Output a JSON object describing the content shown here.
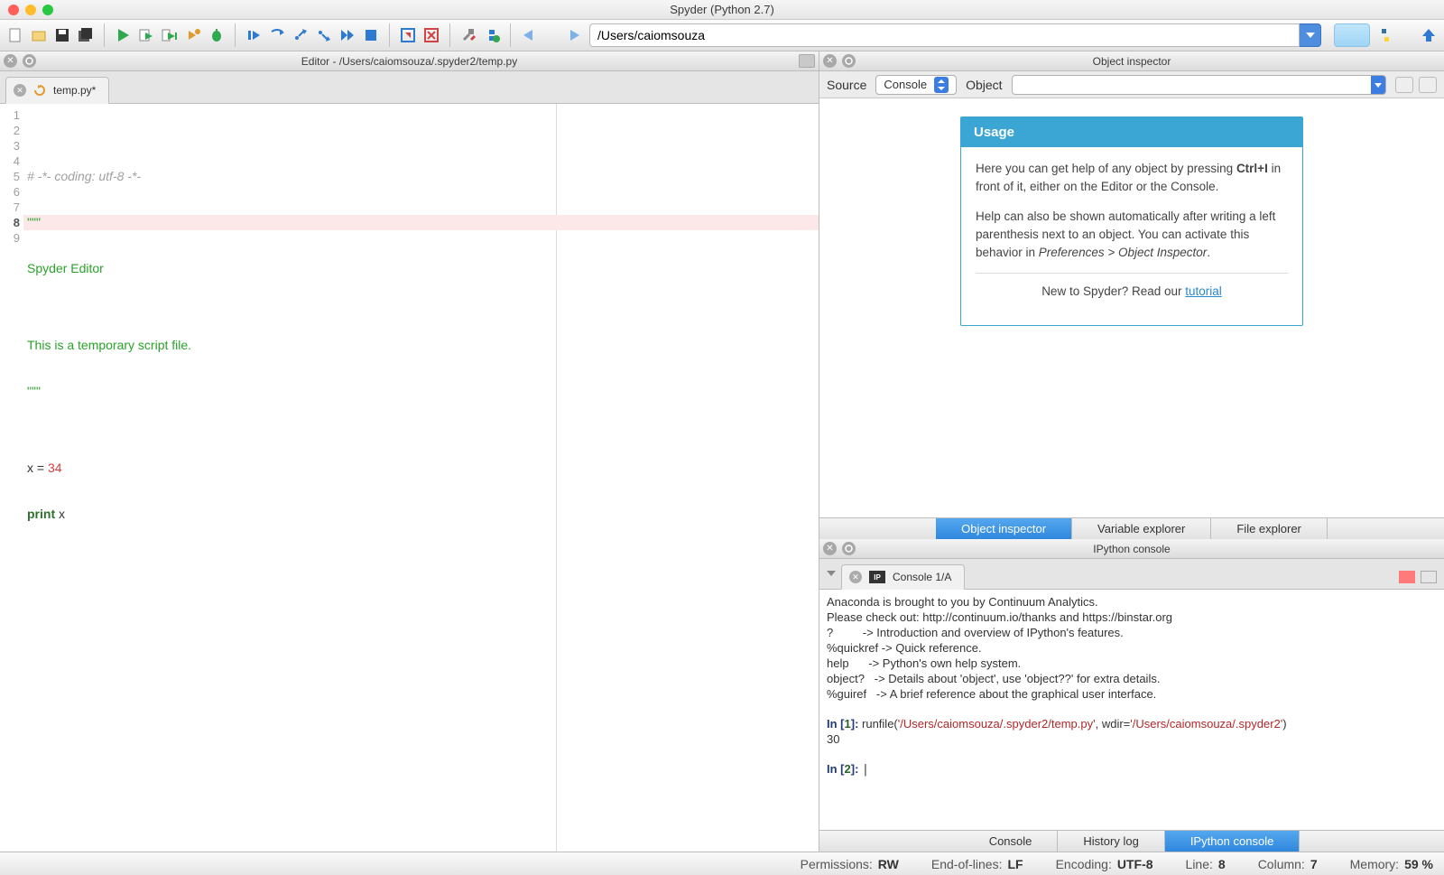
{
  "titlebar": {
    "title": "Spyder (Python 2.7)"
  },
  "toolbar": {
    "path_value": "/Users/caiomsouza"
  },
  "editor": {
    "pane_title": "Editor - /Users/caiomsouza/.spyder2/temp.py",
    "tab_label": "temp.py*",
    "lines": {
      "1": "# -*- coding: utf-8 -*-",
      "2": "\"\"\"",
      "3": "Spyder Editor",
      "4": "",
      "5": "This is a temporary script file.",
      "6": "\"\"\"",
      "7": "",
      "8a": "x ",
      "8b": "= ",
      "8c": "34",
      "9a": "print",
      "9b": " x"
    },
    "linenos": {
      "1": "1",
      "2": "2",
      "3": "3",
      "4": "4",
      "5": "5",
      "6": "6",
      "7": "7",
      "8": "8",
      "9": "9"
    }
  },
  "inspector": {
    "pane_title": "Object inspector",
    "source_label": "Source",
    "source_value": "Console",
    "object_label": "Object",
    "usage_header": "Usage",
    "usage_p1a": "Here you can get help of any object by pressing ",
    "usage_p1b": "Ctrl+I",
    "usage_p1c": " in front of it, either on the Editor or the Console.",
    "usage_p2a": "Help can also be shown automatically after writing a left parenthesis next to an object. You can activate this behavior in ",
    "usage_p2b": "Preferences > Object Inspector",
    "usage_p2c": ".",
    "tutorial_a": "New to Spyder? Read our ",
    "tutorial_link": "tutorial",
    "subtabs": {
      "obj": "Object inspector",
      "var": "Variable explorer",
      "file": "File explorer"
    }
  },
  "ipython": {
    "pane_title": "IPython console",
    "tab_label": "Console 1/A",
    "text_block": "Anaconda is brought to you by Continuum Analytics.\nPlease check out: http://continuum.io/thanks and https://binstar.org\n?         -> Introduction and overview of IPython's features.\n%quickref -> Quick reference.\nhelp      -> Python's own help system.\nobject?   -> Details about 'object', use 'object??' for extra details.\n%guiref   -> A brief reference about the graphical user interface.\n",
    "in1_pre": "In [",
    "in1_num": "1",
    "in1_post": "]: ",
    "in1_call": "runfile(",
    "in1_arg1": "'/Users/caiomsouza/.spyder2/temp.py'",
    "in1_mid": ", wdir=",
    "in1_arg2": "'/Users/caiomsouza/.spyder2'",
    "in1_end": ")",
    "out1": "30",
    "in2_pre": "In [",
    "in2_num": "2",
    "in2_post": "]: ",
    "subtabs": {
      "console": "Console",
      "history": "History log",
      "ipy": "IPython console"
    }
  },
  "statusbar": {
    "perm_l": "Permissions:",
    "perm_v": "RW",
    "eol_l": "End-of-lines:",
    "eol_v": "LF",
    "enc_l": "Encoding:",
    "enc_v": "UTF-8",
    "line_l": "Line:",
    "line_v": "8",
    "col_l": "Column:",
    "col_v": "7",
    "mem_l": "Memory:",
    "mem_v": "59 %"
  }
}
